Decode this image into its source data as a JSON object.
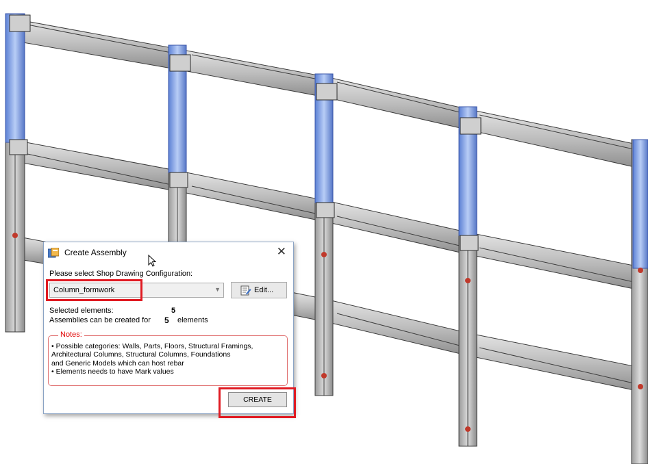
{
  "dialog": {
    "title": "Create Assembly",
    "close_glyph": "✕",
    "prompt": "Please select Shop Drawing Configuration:",
    "configuration": {
      "selected": "Column_formwork"
    },
    "edit_button": "Edit...",
    "selected_elements_label": "Selected elements:",
    "selected_elements_count": "5",
    "assemblies_label": "Assemblies can be created for",
    "assemblies_count": "5",
    "assemblies_suffix": "elements",
    "notes_title": "Notes:",
    "notes_text": "• Possible categories: Walls, Parts, Floors, Structural Framings,\nArchitectural Columns, Structural Columns, Foundations\nand Generic Models which can host rebar\n• Elements needs to have Mark values",
    "create_button": "CREATE"
  },
  "icons": [
    "app-icon",
    "edit-icon",
    "close-icon",
    "chevron-down-icon",
    "cursor-icon"
  ],
  "colors": {
    "highlight": "#e01a22",
    "notes_title": "#e00000",
    "selected_column": "#7b9fe8",
    "concrete": "#9a9a9a"
  }
}
